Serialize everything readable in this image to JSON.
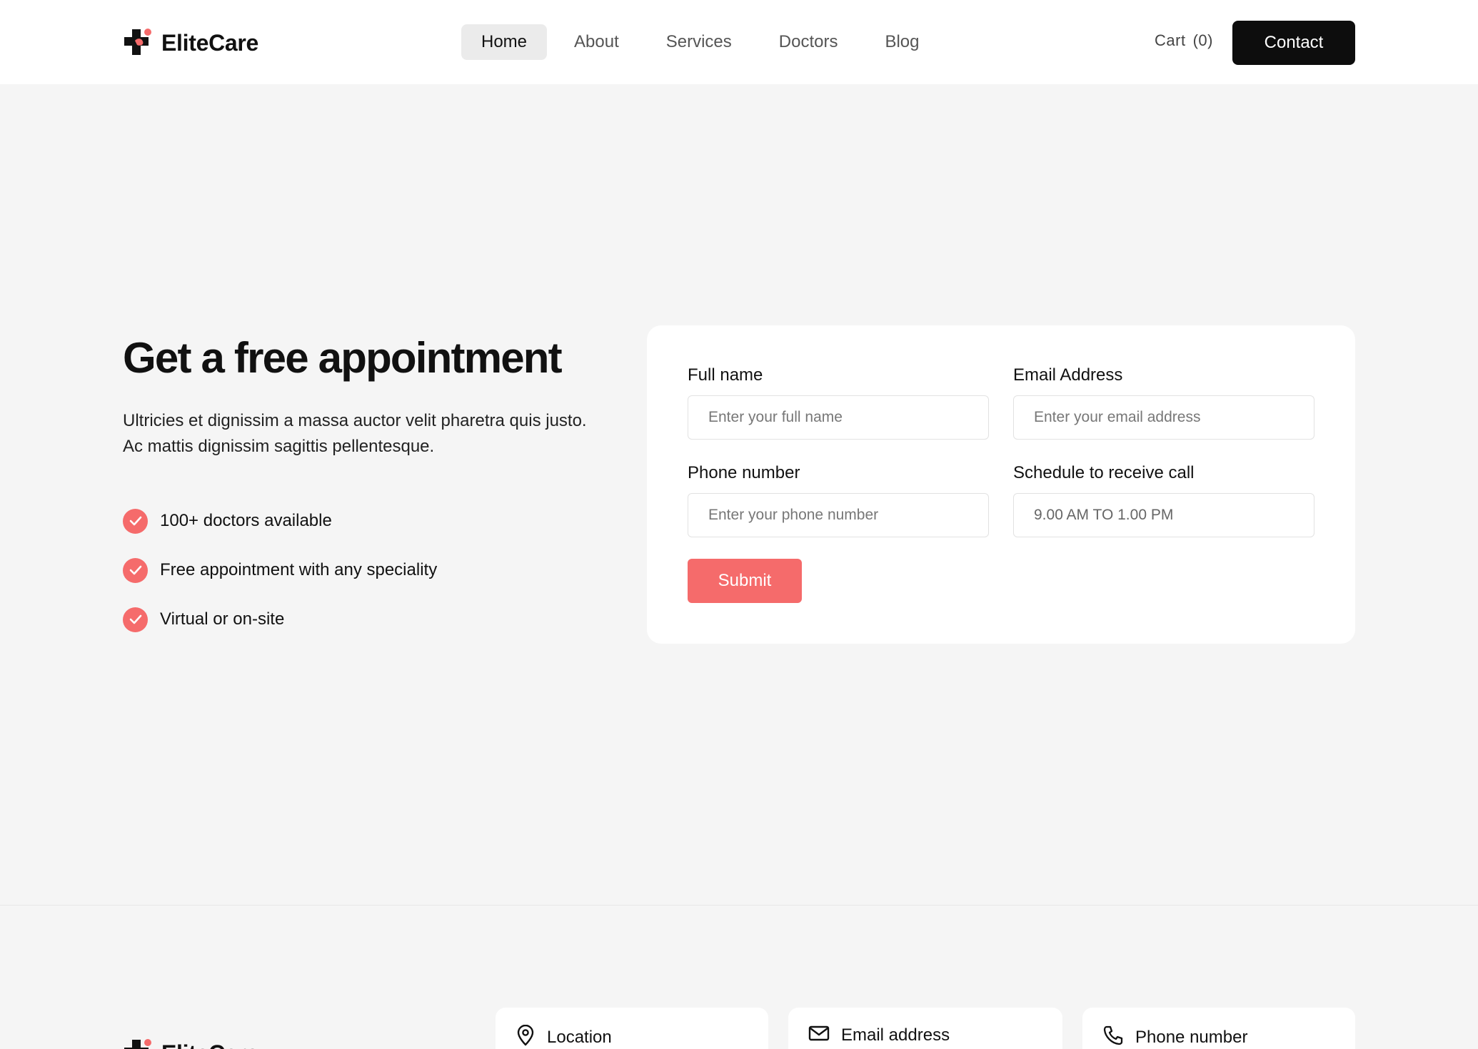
{
  "brand": {
    "name": "EliteCare",
    "accent_color": "#f56b6b",
    "mark_color": "#111111"
  },
  "nav": {
    "items": [
      {
        "label": "Home",
        "active": true
      },
      {
        "label": "About",
        "active": false
      },
      {
        "label": "Services",
        "active": false
      },
      {
        "label": "Doctors",
        "active": false
      },
      {
        "label": "Blog",
        "active": false
      }
    ]
  },
  "header": {
    "cart_label": "Cart",
    "cart_count": "(0)",
    "contact_label": "Contact"
  },
  "hero": {
    "title": "Get a free appointment",
    "description": "Ultricies et dignissim a massa auctor velit pharetra quis justo. Ac mattis dignissim sagittis pellentesque.",
    "features": [
      {
        "icon": "check-circle-icon",
        "text": "100+ doctors available"
      },
      {
        "icon": "check-circle-icon",
        "text": "Free appointment with any speciality"
      },
      {
        "icon": "check-circle-icon",
        "text": "Virtual or on-site"
      }
    ]
  },
  "form": {
    "full_name": {
      "label": "Full name",
      "placeholder": "Enter your full name"
    },
    "email": {
      "label": "Email Address",
      "placeholder": "Enter your email address"
    },
    "phone": {
      "label": "Phone number",
      "placeholder": "Enter your phone number"
    },
    "schedule": {
      "label": "Schedule to receive call",
      "value": "9.00 AM TO 1.00 PM"
    },
    "submit_label": "Submit"
  },
  "footer": {
    "brand_name": "EliteCare",
    "info_cards": [
      {
        "icon": "location-pin-icon",
        "label": "Location"
      },
      {
        "icon": "mail-icon",
        "label": "Email address"
      },
      {
        "icon": "phone-icon",
        "label": "Phone number"
      }
    ]
  }
}
